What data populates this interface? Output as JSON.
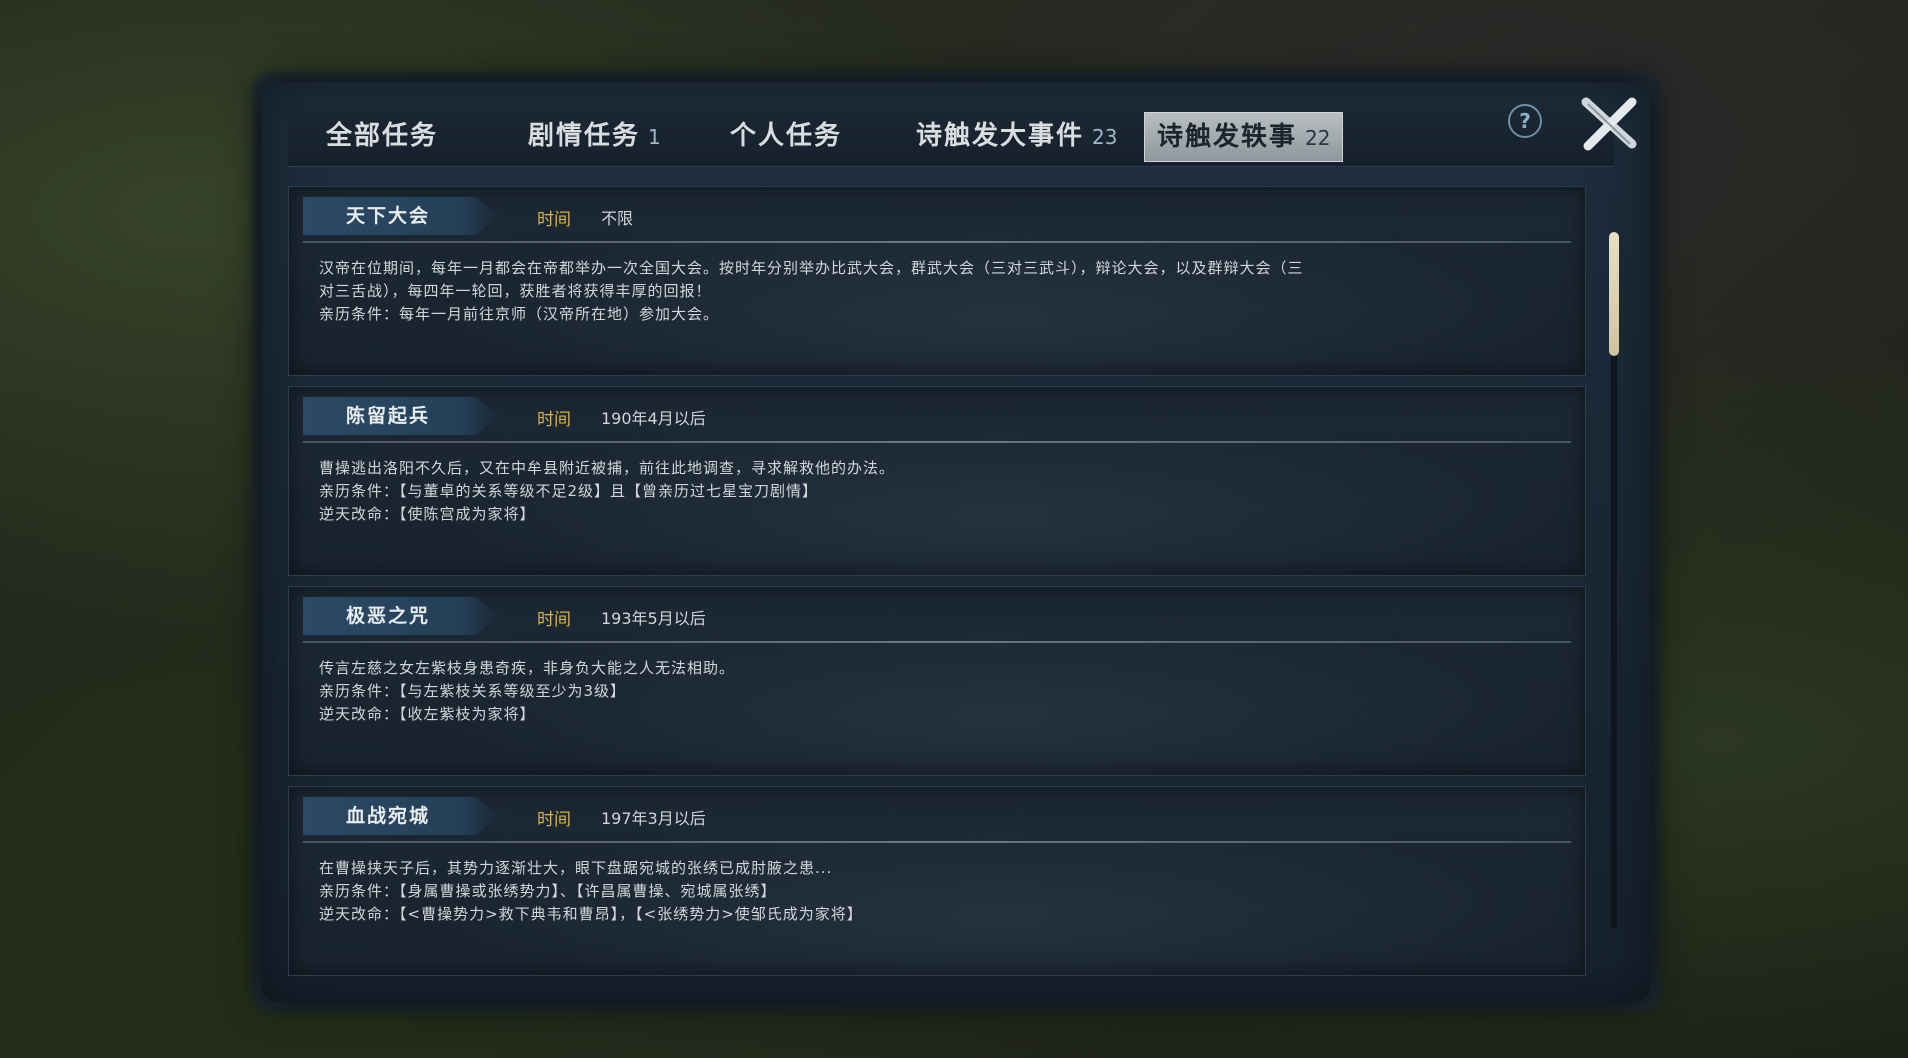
{
  "tabs": [
    {
      "label": "全部任务",
      "count": ""
    },
    {
      "label": "剧情任务",
      "count": "1"
    },
    {
      "label": "个人任务",
      "count": ""
    },
    {
      "label": "诗触发大事件",
      "count": "23"
    },
    {
      "label": "诗触发轶事",
      "count": "22"
    }
  ],
  "active_tab_index": 4,
  "help_icon": "?",
  "time_label": "时间",
  "events": [
    {
      "title": "天下大会",
      "time": "不限",
      "lines": [
        "汉帝在位期间，每年一月都会在帝都举办一次全国大会。按时年分别举办比武大会，群武大会（三对三武斗），辩论大会，以及群辩大会（三",
        "对三舌战），每四年一轮回，获胜者将获得丰厚的回报！",
        "亲历条件：每年一月前往京师（汉帝所在地）参加大会。"
      ]
    },
    {
      "title": "陈留起兵",
      "time": "190年4月以后",
      "lines": [
        "曹操逃出洛阳不久后，又在中牟县附近被捕，前往此地调查，寻求解救他的办法。",
        "亲历条件：【与董卓的关系等级不足2级】且【曾亲历过七星宝刀剧情】",
        "逆天改命：【使陈宫成为家将】"
      ]
    },
    {
      "title": "极恶之咒",
      "time": "193年5月以后",
      "lines": [
        "传言左慈之女左紫枝身患奇疾，非身负大能之人无法相助。",
        "亲历条件：【与左紫枝关系等级至少为3级】",
        "逆天改命：【收左紫枝为家将】"
      ]
    },
    {
      "title": "血战宛城",
      "time": "197年3月以后",
      "lines": [
        "在曹操挟天子后，其势力逐渐壮大，眼下盘踞宛城的张绣已成肘腋之患...",
        "亲历条件：【身属曹操或张绣势力】、【许昌属曹操、宛城属张绣】",
        "逆天改命：【<曹操势力>救下典韦和曹昂】，【<张绣势力>使邹氏成为家将】"
      ]
    }
  ],
  "colors": {
    "time_label": "#d6b34a",
    "active_tab": "#b9bfc2",
    "panel": "#1a2836"
  }
}
